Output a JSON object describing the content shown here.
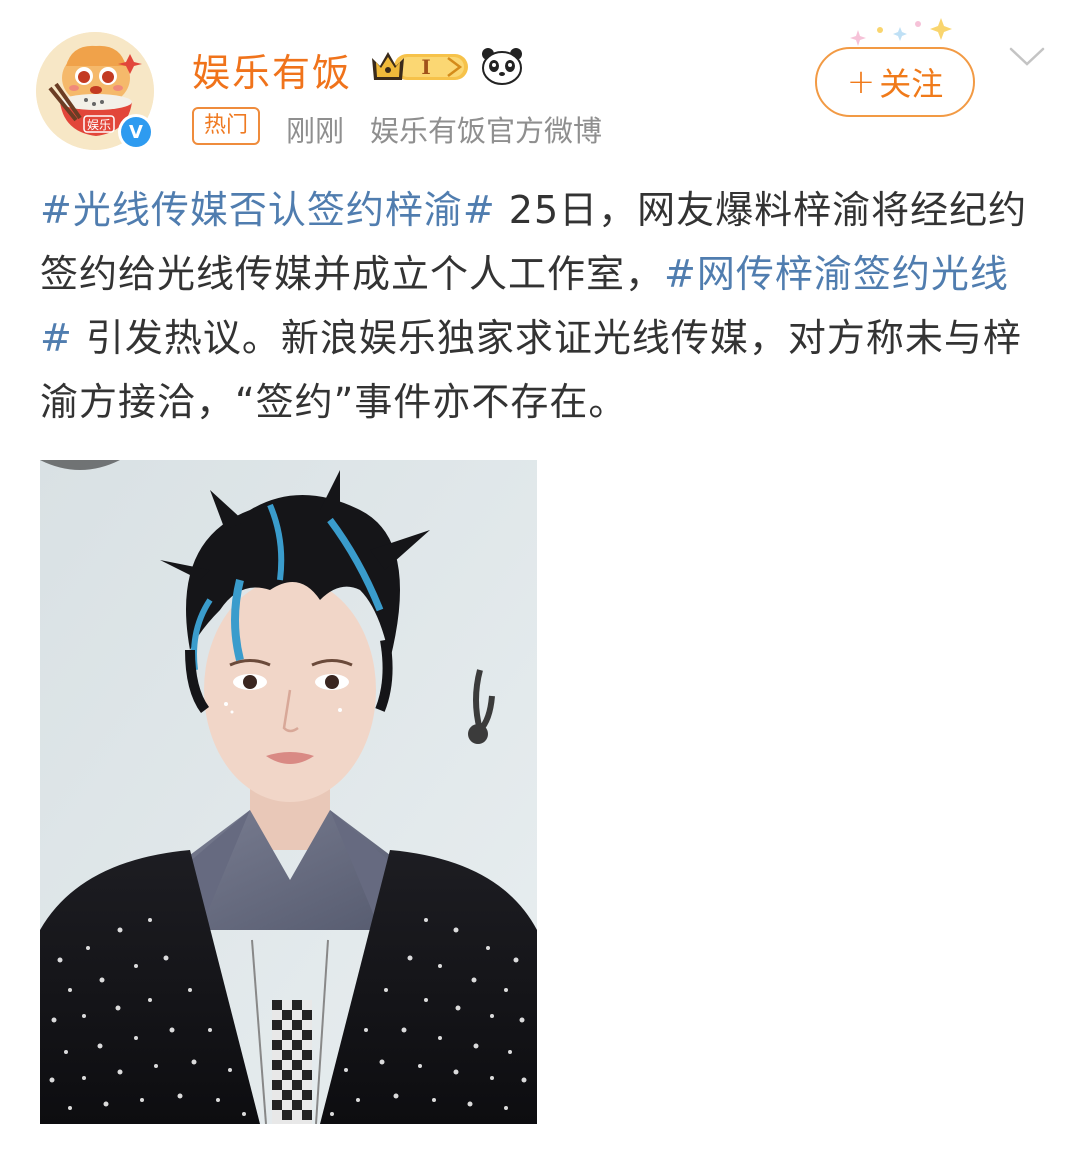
{
  "post": {
    "author": {
      "name": "娱乐有饭",
      "avatar_text": "娱乐",
      "verified_mark": "V",
      "badge_text": "I"
    },
    "meta": {
      "hot_tag": "热门",
      "time": "刚刚",
      "source": "娱乐有饭官方微博"
    },
    "follow_button": {
      "plus": "+",
      "label": "关注"
    },
    "content": {
      "topic1": "#光线传媒否认签约梓渝#",
      "text1": " 25日，网友爆料梓渝将经纪约签约给光线传媒并成立个人工作室，",
      "topic2": "#网传梓渝签约光线#",
      "text2": " 引发热议。新浪娱乐独家求证光线传媒，对方称未与梓渝方接洽，“签约”事件亦不存在。"
    },
    "photo_alt": "portrait photo"
  },
  "colors": {
    "username": "#f0731b",
    "topic": "#507daf",
    "text": "#333333",
    "meta": "#8f8f8f",
    "accent_orange": "#f29a44"
  }
}
